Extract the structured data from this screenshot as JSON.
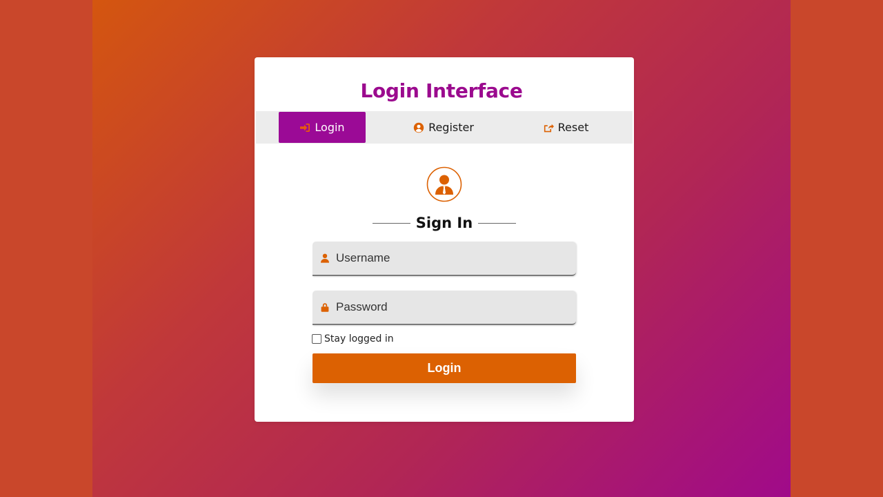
{
  "app": {
    "title": "Login Interface"
  },
  "tabs": [
    {
      "label": "Login",
      "icon": "sign-in-icon",
      "active": true
    },
    {
      "label": "Register",
      "icon": "user-circle-icon",
      "active": false
    },
    {
      "label": "Reset",
      "icon": "share-square-icon",
      "active": false
    }
  ],
  "form": {
    "heading": "Sign In",
    "avatar_icon": "user-tie-icon",
    "username": {
      "placeholder": "Username",
      "value": "",
      "icon": "user-icon"
    },
    "password": {
      "placeholder": "Password",
      "value": "",
      "icon": "lock-icon"
    },
    "remember": {
      "label": "Stay logged in",
      "checked": false
    },
    "submit_label": "Login"
  },
  "colors": {
    "accent_purple": "#9b0a8e",
    "accent_orange": "#dc6102",
    "background_start": "#d4560f",
    "background_end": "#a00a8a"
  }
}
